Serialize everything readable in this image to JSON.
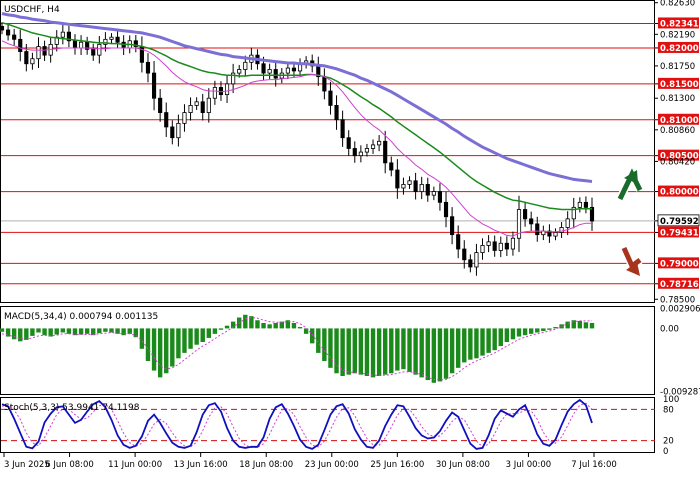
{
  "chart_data": [
    {
      "type": "candlestick",
      "title": "USDCHF, H4",
      "ylim": [
        0.7849,
        0.8264
      ],
      "y_ticks": [
        "0.82630",
        "0.82341",
        "0.82190",
        "0.82000",
        "0.81750",
        "0.81500",
        "0.81300",
        "0.81000",
        "0.80860",
        "0.80500",
        "0.80420",
        "0.80000",
        "0.79592",
        "0.79431",
        "0.79000",
        "0.78716",
        "0.78500"
      ],
      "resistance_levels": [
        {
          "label": "0.82341",
          "value": 0.82341
        },
        {
          "label": "0.82000",
          "value": 0.82
        },
        {
          "label": "0.81500",
          "value": 0.815
        },
        {
          "label": "0.81000",
          "value": 0.81
        },
        {
          "label": "0.80500",
          "value": 0.805
        },
        {
          "label": "0.80000",
          "value": 0.8
        }
      ],
      "support_levels": [
        {
          "label": "0.79431",
          "value": 0.79431
        },
        {
          "label": "0.79000",
          "value": 0.79
        },
        {
          "label": "0.78716",
          "value": 0.78716
        }
      ],
      "current_price": {
        "label": "0.79592",
        "value": 0.79592
      },
      "close_series": [
        0.8225,
        0.8218,
        0.8212,
        0.8195,
        0.8178,
        0.8185,
        0.8202,
        0.819,
        0.8205,
        0.8215,
        0.8222,
        0.821,
        0.82,
        0.8208,
        0.8198,
        0.819,
        0.8205,
        0.8212,
        0.8215,
        0.8208,
        0.82,
        0.821,
        0.8202,
        0.818,
        0.8165,
        0.813,
        0.811,
        0.809,
        0.8075,
        0.8095,
        0.811,
        0.812,
        0.8125,
        0.811,
        0.813,
        0.8145,
        0.8135,
        0.815,
        0.8165,
        0.817,
        0.818,
        0.819,
        0.8178,
        0.8165,
        0.817,
        0.8158,
        0.8165,
        0.8172,
        0.8168,
        0.8178,
        0.8182,
        0.8175,
        0.816,
        0.814,
        0.812,
        0.81,
        0.8075,
        0.806,
        0.805,
        0.8055,
        0.806,
        0.8065,
        0.807,
        0.804,
        0.803,
        0.8005,
        0.801,
        0.8015,
        0.8,
        0.801,
        0.7995,
        0.8,
        0.7985,
        0.7965,
        0.794,
        0.792,
        0.7905,
        0.7895,
        0.7915,
        0.7925,
        0.793,
        0.7918,
        0.7928,
        0.792,
        0.7935,
        0.7975,
        0.7962,
        0.7955,
        0.794,
        0.7945,
        0.7938,
        0.7943,
        0.795,
        0.7962,
        0.7978,
        0.7985,
        0.7978,
        0.7959
      ],
      "ma_fast": [
        0.821,
        0.8206,
        0.8203,
        0.82,
        0.8198,
        0.8197,
        0.8197,
        0.8197,
        0.8198,
        0.8199,
        0.82,
        0.82,
        0.82,
        0.82,
        0.82,
        0.8199,
        0.8199,
        0.8199,
        0.82,
        0.82,
        0.82,
        0.82,
        0.82,
        0.8198,
        0.8195,
        0.819,
        0.8183,
        0.8175,
        0.8166,
        0.8159,
        0.8153,
        0.8149,
        0.8146,
        0.8142,
        0.814,
        0.814,
        0.8139,
        0.814,
        0.8142,
        0.8145,
        0.8148,
        0.8152,
        0.8154,
        0.8155,
        0.8156,
        0.8156,
        0.8157,
        0.8158,
        0.8159,
        0.816,
        0.8162,
        0.8163,
        0.8162,
        0.816,
        0.8155,
        0.8148,
        0.8139,
        0.8128,
        0.8117,
        0.8107,
        0.8099,
        0.8092,
        0.8086,
        0.8078,
        0.807,
        0.806,
        0.8052,
        0.8045,
        0.8037,
        0.8031,
        0.8024,
        0.8019,
        0.8013,
        0.8006,
        0.7997,
        0.7987,
        0.7977,
        0.7967,
        0.7961,
        0.7955,
        0.7951,
        0.7946,
        0.7943,
        0.7939,
        0.7938,
        0.7942,
        0.7944,
        0.7945,
        0.7945,
        0.7945,
        0.7944,
        0.7944,
        0.7945,
        0.7947,
        0.795,
        0.7954,
        0.7956,
        0.7956
      ],
      "ma_mid": [
        0.8235,
        0.8233,
        0.823,
        0.8227,
        0.8224,
        0.8221,
        0.8219,
        0.8217,
        0.8215,
        0.8214,
        0.8213,
        0.8212,
        0.8211,
        0.821,
        0.8209,
        0.8208,
        0.8207,
        0.8207,
        0.8206,
        0.8206,
        0.8205,
        0.8205,
        0.8204,
        0.8202,
        0.82,
        0.8197,
        0.8193,
        0.8189,
        0.8184,
        0.818,
        0.8177,
        0.8174,
        0.8171,
        0.8168,
        0.8166,
        0.8165,
        0.8163,
        0.8162,
        0.8162,
        0.8161,
        0.8161,
        0.8162,
        0.8162,
        0.8162,
        0.8162,
        0.8162,
        0.8162,
        0.8162,
        0.8162,
        0.8162,
        0.8163,
        0.8163,
        0.8162,
        0.816,
        0.8158,
        0.8154,
        0.8149,
        0.8144,
        0.8138,
        0.8132,
        0.8127,
        0.8121,
        0.8116,
        0.811,
        0.8104,
        0.8097,
        0.8091,
        0.8085,
        0.8079,
        0.8073,
        0.8067,
        0.8061,
        0.8055,
        0.8048,
        0.8041,
        0.8034,
        0.8027,
        0.802,
        0.8014,
        0.8009,
        0.8004,
        0.7999,
        0.7995,
        0.7991,
        0.7988,
        0.7987,
        0.7985,
        0.7983,
        0.7981,
        0.7979,
        0.7977,
        0.7976,
        0.7975,
        0.7975,
        0.7975,
        0.7976,
        0.7976,
        0.7976
      ],
      "ma_slow": [
        0.8248,
        0.8246,
        0.8245,
        0.8243,
        0.8242,
        0.824,
        0.8239,
        0.8238,
        0.8236,
        0.8235,
        0.8234,
        0.8233,
        0.8232,
        0.8231,
        0.823,
        0.8229,
        0.8228,
        0.8227,
        0.8226,
        0.8225,
        0.8224,
        0.8223,
        0.8222,
        0.8221,
        0.8219,
        0.8217,
        0.8215,
        0.8212,
        0.8209,
        0.8206,
        0.8203,
        0.8201,
        0.8199,
        0.8197,
        0.8195,
        0.8193,
        0.8191,
        0.819,
        0.8188,
        0.8187,
        0.8186,
        0.8185,
        0.8184,
        0.8183,
        0.8182,
        0.8181,
        0.818,
        0.8179,
        0.8179,
        0.8178,
        0.8178,
        0.8177,
        0.8176,
        0.8175,
        0.8173,
        0.8171,
        0.8168,
        0.8165,
        0.8162,
        0.8158,
        0.8155,
        0.8151,
        0.8147,
        0.8143,
        0.8139,
        0.8134,
        0.8129,
        0.8124,
        0.8119,
        0.8114,
        0.8109,
        0.8104,
        0.8099,
        0.8094,
        0.8088,
        0.8083,
        0.8077,
        0.8072,
        0.8067,
        0.8062,
        0.8058,
        0.8054,
        0.805,
        0.8046,
        0.8043,
        0.804,
        0.8037,
        0.8034,
        0.8031,
        0.8028,
        0.8025,
        0.8023,
        0.8021,
        0.8019,
        0.8017,
        0.8016,
        0.8015,
        0.8014
      ],
      "x_labels": [
        "3 Jun 2025",
        "6 Jun 08:00",
        "11 Jun 00:00",
        "13 Jun 16:00",
        "18 Jun 08:00",
        "23 Jun 00:00",
        "25 Jun 16:00",
        "30 Jun 08:00",
        "3 Jul 00:00",
        "7 Jul 16:00"
      ]
    },
    {
      "type": "bar",
      "title": "MACD(5,34,4) 0.000794 0.001135",
      "ylim": [
        -0.0095,
        0.003
      ],
      "y_ticks": [
        "0.002906",
        "0.00",
        "-0.009287"
      ],
      "values": [
        -0.0005,
        -0.0012,
        -0.0016,
        -0.0019,
        -0.0017,
        -0.0011,
        -0.0006,
        -0.001,
        -0.0012,
        -0.0009,
        -0.0006,
        -0.0008,
        -0.001,
        -0.0009,
        -0.0008,
        -0.001,
        -0.0007,
        -0.0005,
        -0.0006,
        -0.0008,
        -0.001,
        -0.0008,
        -0.0013,
        -0.003,
        -0.0048,
        -0.0062,
        -0.0072,
        -0.0066,
        -0.0056,
        -0.0044,
        -0.0036,
        -0.003,
        -0.0024,
        -0.002,
        -0.0014,
        -0.0008,
        -0.0002,
        0.0004,
        0.001,
        0.0016,
        0.002,
        0.0018,
        0.0012,
        0.0008,
        0.0006,
        0.0008,
        0.001,
        0.0012,
        0.0008,
        0.0002,
        -0.0008,
        -0.0022,
        -0.0036,
        -0.0048,
        -0.0058,
        -0.0066,
        -0.007,
        -0.0068,
        -0.0066,
        -0.0068,
        -0.007,
        -0.0072,
        -0.007,
        -0.0068,
        -0.0066,
        -0.0062,
        -0.006,
        -0.0064,
        -0.0068,
        -0.0072,
        -0.0076,
        -0.008,
        -0.0078,
        -0.0074,
        -0.0066,
        -0.0058,
        -0.005,
        -0.0046,
        -0.0044,
        -0.004,
        -0.0036,
        -0.0032,
        -0.0026,
        -0.002,
        -0.0016,
        -0.0012,
        -0.001,
        -0.0008,
        -0.0006,
        -0.0004,
        -0.0002,
        0.0002,
        0.0006,
        0.001,
        0.0012,
        0.0011,
        0.0009,
        0.0008
      ],
      "signal": [
        -0.0008,
        -0.001,
        -0.0012,
        -0.0015,
        -0.0016,
        -0.0014,
        -0.0011,
        -0.001,
        -0.0011,
        -0.001,
        -0.0008,
        -0.0008,
        -0.0009,
        -0.0009,
        -0.0009,
        -0.0009,
        -0.0008,
        -0.0007,
        -0.0006,
        -0.0007,
        -0.0008,
        -0.0008,
        -0.001,
        -0.0018,
        -0.003,
        -0.0043,
        -0.0055,
        -0.006,
        -0.0058,
        -0.0053,
        -0.0046,
        -0.0039,
        -0.0032,
        -0.0026,
        -0.0021,
        -0.0015,
        -0.0009,
        -0.0004,
        0.0002,
        0.0008,
        0.0014,
        0.0016,
        0.0015,
        0.0012,
        0.001,
        0.0009,
        0.0009,
        0.001,
        0.001,
        0.0007,
        0.0001,
        -0.0009,
        -0.0021,
        -0.0033,
        -0.0044,
        -0.0054,
        -0.0061,
        -0.0064,
        -0.0065,
        -0.0066,
        -0.0067,
        -0.0069,
        -0.0069,
        -0.0069,
        -0.0068,
        -0.0066,
        -0.0064,
        -0.0064,
        -0.0065,
        -0.0068,
        -0.0072,
        -0.0075,
        -0.0076,
        -0.0075,
        -0.0071,
        -0.0065,
        -0.0058,
        -0.0052,
        -0.0048,
        -0.0044,
        -0.004,
        -0.0036,
        -0.0031,
        -0.0026,
        -0.0021,
        -0.0016,
        -0.0013,
        -0.001,
        -0.0008,
        -0.0006,
        -0.0004,
        -0.0001,
        0.0003,
        0.0007,
        0.001,
        0.0011,
        0.0011,
        0.0011
      ]
    },
    {
      "type": "line",
      "title": "Stoch(5,3,3) 53.9941 74.1198",
      "ylim": [
        0,
        100
      ],
      "y_ticks": [
        "100",
        "80",
        "20",
        "0"
      ],
      "levels": [
        80,
        20
      ],
      "k_line": [
        90,
        86,
        62,
        35,
        8,
        5,
        18,
        55,
        72,
        84,
        86,
        70,
        54,
        60,
        76,
        90,
        96,
        84,
        60,
        30,
        12,
        6,
        10,
        28,
        58,
        70,
        54,
        34,
        16,
        8,
        6,
        10,
        36,
        70,
        88,
        92,
        76,
        44,
        20,
        8,
        6,
        8,
        8,
        26,
        62,
        84,
        90,
        72,
        48,
        22,
        8,
        4,
        12,
        40,
        70,
        86,
        90,
        72,
        42,
        22,
        8,
        6,
        20,
        48,
        70,
        88,
        86,
        66,
        44,
        30,
        24,
        26,
        38,
        58,
        74,
        66,
        40,
        14,
        4,
        6,
        30,
        62,
        78,
        72,
        66,
        80,
        88,
        62,
        32,
        14,
        10,
        22,
        50,
        76,
        90,
        98,
        88,
        54
      ],
      "d_line": [
        86,
        88,
        79,
        61,
        35,
        16,
        10,
        26,
        48,
        70,
        81,
        80,
        70,
        61,
        63,
        75,
        87,
        90,
        80,
        58,
        34,
        16,
        9,
        15,
        32,
        52,
        61,
        53,
        35,
        19,
        10,
        8,
        17,
        39,
        65,
        83,
        85,
        71,
        47,
        24,
        11,
        7,
        7,
        14,
        32,
        57,
        79,
        82,
        70,
        47,
        26,
        11,
        8,
        19,
        41,
        65,
        82,
        83,
        68,
        45,
        24,
        12,
        11,
        25,
        46,
        69,
        81,
        80,
        65,
        47,
        33,
        27,
        29,
        41,
        57,
        66,
        60,
        40,
        19,
        8,
        13,
        33,
        57,
        71,
        72,
        73,
        78,
        77,
        61,
        36,
        19,
        15,
        27,
        49,
        72,
        88,
        92,
        80
      ]
    }
  ]
}
